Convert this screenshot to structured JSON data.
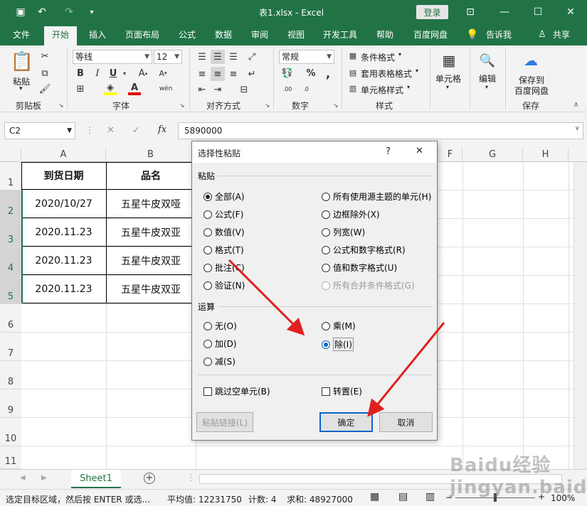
{
  "titlebar": {
    "title": "表1.xlsx  -  Excel",
    "login": "登录",
    "close": "✕"
  },
  "tabs": [
    "文件",
    "开始",
    "插入",
    "页面布局",
    "公式",
    "数据",
    "审阅",
    "视图",
    "开发工具",
    "帮助",
    "百度网盘",
    "告诉我",
    "共享"
  ],
  "ribbon": {
    "paste": "粘贴",
    "font_name": "等线",
    "font_size": "12",
    "number_format": "常规",
    "conditional": "条件格式",
    "table_format": "套用表格格式",
    "cell_style": "单元格样式",
    "cells": "单元格",
    "edit": "编辑",
    "save_to": "保存到",
    "baidu": "百度网盘",
    "groups": {
      "clipboard": "剪贴板",
      "font": "字体",
      "align": "对齐方式",
      "number": "数字",
      "style": "样式",
      "save": "保存"
    }
  },
  "formula": {
    "namebox": "C2",
    "fx": "fx",
    "value": "5890000"
  },
  "columns": [
    "A",
    "B",
    "F",
    "G",
    "H"
  ],
  "rows": [
    "1",
    "2",
    "3",
    "4",
    "5",
    "6",
    "7",
    "8",
    "9",
    "10",
    "11"
  ],
  "table": {
    "header": [
      "到货日期",
      "品名"
    ],
    "data": [
      [
        "2020/10/27",
        "五星牛皮双哑"
      ],
      [
        "2020.11.23",
        "五星牛皮双亚"
      ],
      [
        "2020.11.23",
        "五星牛皮双亚"
      ],
      [
        "2020.11.23",
        "五星牛皮双亚"
      ]
    ]
  },
  "dialog": {
    "title": "选择性粘贴",
    "help": "?",
    "close": "✕",
    "paste_section": "粘贴",
    "paste_left": [
      "全部(A)",
      "公式(F)",
      "数值(V)",
      "格式(T)",
      "批注(C)",
      "验证(N)"
    ],
    "paste_right": [
      "所有使用源主题的单元(H)",
      "边框除外(X)",
      "列宽(W)",
      "公式和数字格式(R)",
      "值和数字格式(U)",
      "所有合并条件格式(G)"
    ],
    "op_section": "运算",
    "op_left": [
      "无(O)",
      "加(D)",
      "减(S)"
    ],
    "op_right": [
      "乘(M)",
      "除(I)"
    ],
    "skip_blanks": "跳过空单元(B)",
    "transpose": "转置(E)",
    "paste_link": "粘贴链接(L)",
    "ok": "确定",
    "cancel": "取消"
  },
  "sheet": {
    "tab": "Sheet1",
    "add": "+"
  },
  "status": {
    "msg": "选定目标区域，然后按 ENTER 或选...",
    "avg": "平均值: 12231750",
    "count": "计数: 4",
    "sum": "求和: 48927000",
    "zoom": "100%"
  },
  "watermark": "Baidu经验 jingyan.baidu.com",
  "colors": {
    "excel_green": "#217346",
    "arrow_red": "#e02020",
    "focus_blue": "#0a64c8"
  }
}
